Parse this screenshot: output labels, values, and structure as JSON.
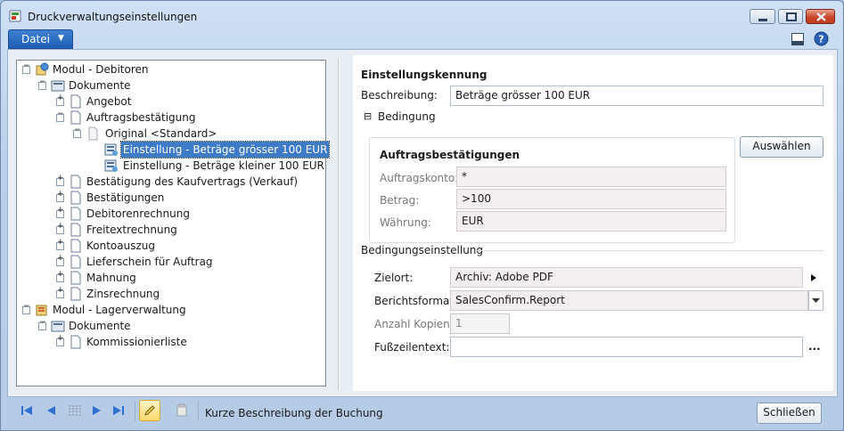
{
  "window": {
    "title": "Druckverwaltungseinstellungen"
  },
  "menu": {
    "file": "Datei"
  },
  "tree": {
    "nodes": [
      {
        "label": "Modul - Debitoren"
      },
      {
        "label": "Dokumente"
      },
      {
        "label": "Angebot"
      },
      {
        "label": "Auftragsbestätigung"
      },
      {
        "label": "Original <Standard>"
      },
      {
        "label": "Einstellung - Beträge grösser 100 EUR"
      },
      {
        "label": "Einstellung - Beträge kleiner 100 EUR"
      },
      {
        "label": "Bestätigung des Kaufvertrags (Verkauf)"
      },
      {
        "label": "Bestätigungen"
      },
      {
        "label": "Debitorenrechnung"
      },
      {
        "label": "Freitextrechnung"
      },
      {
        "label": "Kontoauszug"
      },
      {
        "label": "Lieferschein für Auftrag"
      },
      {
        "label": "Mahnung"
      },
      {
        "label": "Zinsrechnung"
      },
      {
        "label": "Modul - Lagerverwaltung"
      },
      {
        "label": "Dokumente"
      },
      {
        "label": "Kommissionierliste"
      }
    ]
  },
  "detail": {
    "id_section": "Einstellungskennung",
    "description_label": "Beschreibung:",
    "description_value": "Beträge grösser 100 EUR",
    "condition_section": "Bedingung",
    "condition_collapse": "⊟",
    "group_title": "Auftragsbestätigungen",
    "account_label": "Auftragskonto:",
    "account_value": "*",
    "amount_label": "Betrag:",
    "amount_value": ">100",
    "currency_label": "Währung:",
    "currency_value": "EUR",
    "select_button": "Auswählen",
    "settings_section": "Bedingungseinstellung",
    "destination_label": "Zielort:",
    "destination_value": "Archiv: Adobe PDF",
    "format_label": "Berichtsformat:",
    "format_value": "SalesConfirm.Report",
    "copies_label": "Anzahl Kopien:",
    "copies_value": "1",
    "footer_text_label": "Fußzeilentext:",
    "footer_text_value": "",
    "more_button": "..."
  },
  "footer": {
    "status_text": "Kurze Beschreibung der Buchung",
    "close_button": "Schließen"
  }
}
